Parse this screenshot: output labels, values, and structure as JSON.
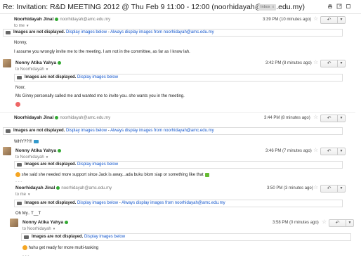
{
  "subject": "Re: Invitation: R&D MEETING 2012 @ Thu Feb 9 11:00 - 12:00 (noorhidayah@amc.edu.my)",
  "label": "Inbox",
  "label_close": "x",
  "icons": [
    "print-icon",
    "new-window-icon",
    "expand-icon"
  ],
  "images_bar": {
    "title": "Images are not displayed.",
    "display_link": "Display images below",
    "separator": " - ",
    "always_link": "Always display images from noorhidayah@amc.edu.my"
  },
  "messages": [
    {
      "sender": "Noorhidayah Jinal",
      "email": "noorhidayah@amc.edu.my",
      "to": "to me",
      "time": "3:39 PM (10 minutes ago)",
      "lines": [
        "Nonny,",
        "I assume you wrongly invite me to the meeting. I am not in the committee, as far as I know lah."
      ]
    },
    {
      "sender": "Nonny Atika Yahya",
      "to": "to Noorhidayah",
      "time": "3:42 PM (8 minutes ago)",
      "lines": [
        "Noor,",
        "Ms Ginny personally called me and wanted me to invite you. she wants you in the meeting."
      ]
    },
    {
      "sender": "Noorhidayah Jinal",
      "email": "noorhidayah@amc.edu.my",
      "to": "to me",
      "time": "3:44 PM (8 minutes ago)",
      "lines": [
        "WHY??!!!"
      ]
    },
    {
      "sender": "Nonny Atika Yahya",
      "to": "to Noorhidayah",
      "time": "3:46 PM (7 minutes ago)",
      "lines": [
        "she said she needed more support since Jack is away...ada buku blom siap or something like that"
      ]
    },
    {
      "sender": "Noorhidayah Jinal",
      "email": "noorhidayah@amc.edu.my",
      "to": "to me",
      "time": "3:50 PM (3 minutes ago)",
      "lines": [
        "Oh My.. T__T"
      ]
    },
    {
      "sender": "Nonny Atika Yahya",
      "to": "to Noorhidayah",
      "time": "3:58 PM (0 minutes ago)",
      "lines": [
        "huhu get ready for more multi-tasking"
      ]
    }
  ],
  "ellipsis": "- - -"
}
